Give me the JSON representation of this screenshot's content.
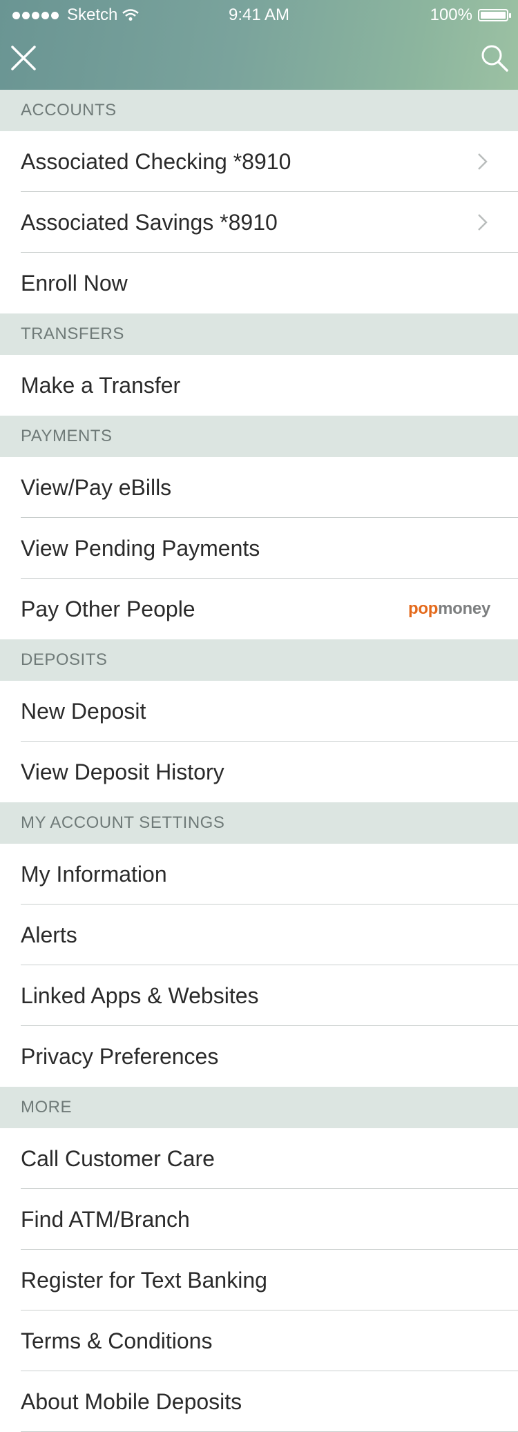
{
  "status_bar": {
    "carrier": "Sketch",
    "time": "9:41 AM",
    "battery": "100%"
  },
  "header": {
    "close_icon": "close-icon",
    "search_icon": "search-icon"
  },
  "sections": {
    "accounts": {
      "title": "ACCOUNTS",
      "items": [
        "Associated Checking *8910",
        "Associated Savings *8910",
        "Enroll Now"
      ]
    },
    "transfers": {
      "title": "TRANSFERS",
      "items": [
        "Make a Transfer"
      ]
    },
    "payments": {
      "title": "PAYMENTS",
      "items": [
        "View/Pay eBills",
        "View Pending Payments",
        "Pay Other People"
      ],
      "popmoney_logo": {
        "pop": "pop",
        "money": "money"
      }
    },
    "deposits": {
      "title": "DEPOSITS",
      "items": [
        "New Deposit",
        "View Deposit History"
      ]
    },
    "settings": {
      "title": "MY ACCOUNT SETTINGS",
      "items": [
        "My Information",
        "Alerts",
        "Linked Apps & Websites",
        "Privacy Preferences"
      ]
    },
    "more": {
      "title": "MORE",
      "items": [
        "Call Customer Care",
        "Find ATM/Branch",
        "Register for Text Banking",
        "Terms & Conditions",
        "About Mobile Deposits"
      ]
    }
  },
  "colors": {
    "header_gradient_start": "#6a9593",
    "header_gradient_end": "#9cc1a3",
    "section_bg": "#dce5e1",
    "popmoney_orange": "#e46a1c"
  }
}
